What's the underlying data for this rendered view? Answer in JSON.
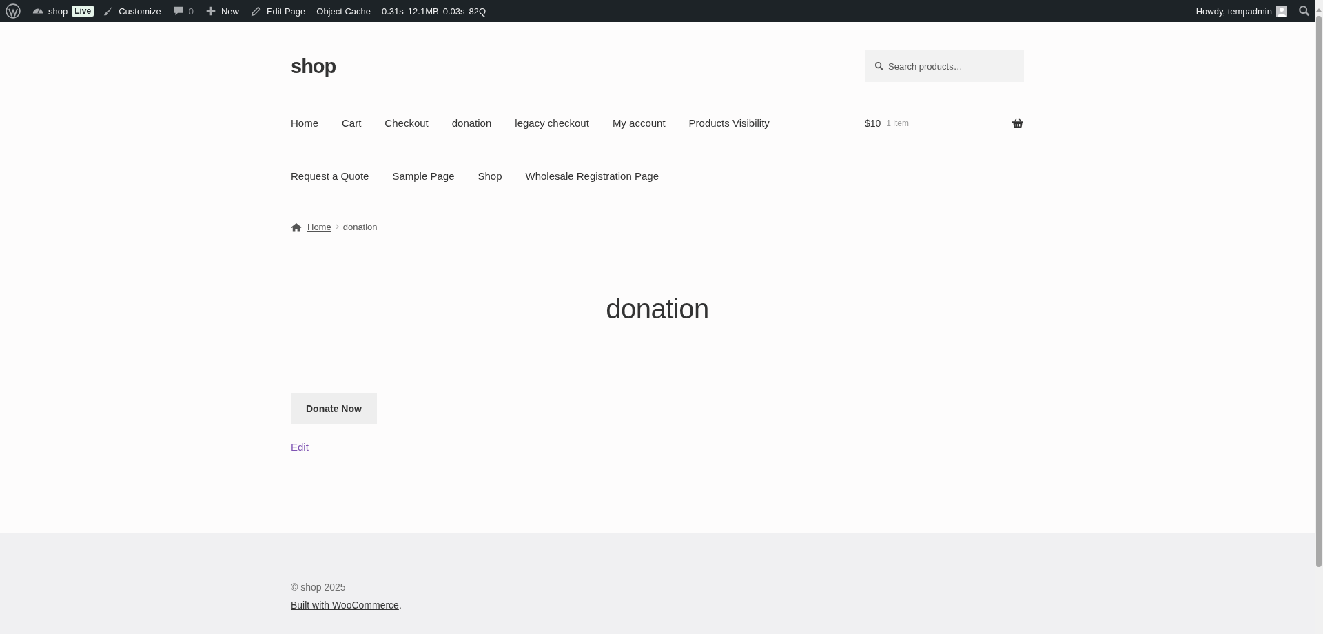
{
  "admin_bar": {
    "items": [
      {
        "kind": "logo"
      },
      {
        "kind": "site",
        "label": "shop",
        "badge": "Live"
      },
      {
        "kind": "customize",
        "label": "Customize"
      },
      {
        "kind": "comments",
        "label": "0"
      },
      {
        "kind": "new",
        "label": "New"
      },
      {
        "kind": "edit",
        "label": "Edit Page"
      },
      {
        "kind": "text",
        "label": "Object Cache"
      }
    ],
    "stats": [
      "0.31s",
      "12.1MB",
      "0.03s",
      "82Q"
    ],
    "greeting": "Howdy, tempadmin"
  },
  "header": {
    "site_title": "shop",
    "search": {
      "placeholder": "Search products…"
    },
    "nav": [
      "Home",
      "Cart",
      "Checkout",
      "donation",
      "legacy checkout",
      "My account",
      "Products Visibility",
      "Request a Quote",
      "Sample Page",
      "Shop",
      "Wholesale Registration Page"
    ],
    "cart": {
      "amount": "$10",
      "count": "1 item"
    }
  },
  "breadcrumb": {
    "home": "Home",
    "current": "donation"
  },
  "page": {
    "title": "donation",
    "button": "Donate Now",
    "edit": "Edit"
  },
  "footer": {
    "copyright": "© shop 2025",
    "credit_link": "Built with WooCommerce",
    "credit_after": "."
  }
}
